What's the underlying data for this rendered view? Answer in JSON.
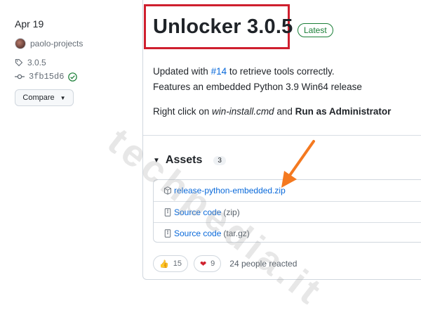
{
  "left": {
    "date": "Apr 19",
    "author": "paolo-projects",
    "tag": "3.0.5",
    "commit": "3fb15d6",
    "compare_label": "Compare"
  },
  "release": {
    "title": "Unlocker 3.0.5",
    "badge": "Latest",
    "line1_prefix": "Updated with ",
    "line1_link": "#14",
    "line1_suffix": " to retrieve tools correctly.",
    "line2": "Features an embedded Python 3.9 Win64 release",
    "line3_prefix": "Right click on ",
    "line3_file": "win-install.cmd",
    "line3_mid": " and ",
    "line3_bold": "Run as Administrator"
  },
  "assets": {
    "title": "Assets",
    "count": "3",
    "items": [
      {
        "name": "release-python-embedded.zip",
        "suffix": ""
      },
      {
        "name": "Source code",
        "suffix": "(zip)"
      },
      {
        "name": "Source code",
        "suffix": "(tar.gz)"
      }
    ]
  },
  "reactions": {
    "thumbs_emoji": "👍",
    "thumbs": "15",
    "heart_emoji": "❤",
    "heart": "9",
    "summary": "24 people reacted"
  },
  "watermark": "techpedia.it",
  "colors": {
    "title_box": "#cf1f2e",
    "arrow": "#f47920",
    "link": "#0969da",
    "latest": "#1a7f37"
  }
}
